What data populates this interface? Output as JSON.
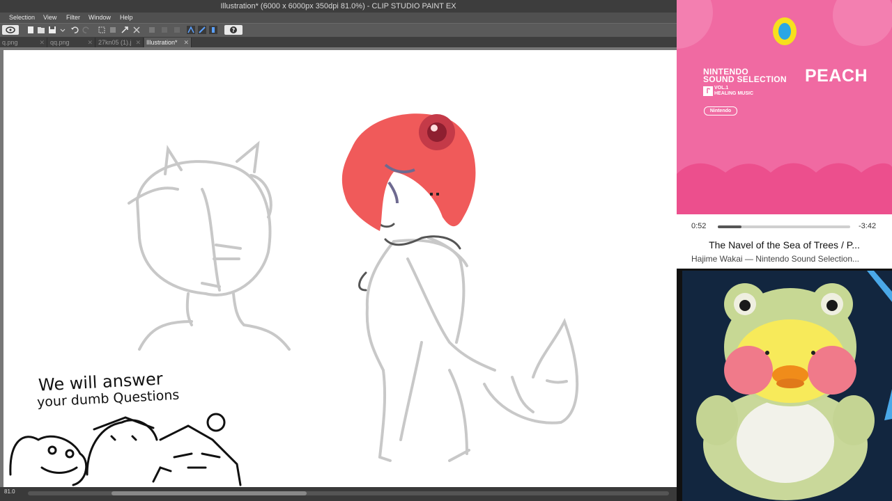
{
  "window": {
    "title": "Illustration* (6000 x 6000px 350dpi 81.0%)  - CLIP STUDIO PAINT EX"
  },
  "menu": {
    "items": [
      "Selection",
      "View",
      "Filter",
      "Window",
      "Help"
    ]
  },
  "tabs": [
    {
      "label": "q.png",
      "active": false
    },
    {
      "label": "qq.png",
      "active": false
    },
    {
      "label": "27kn05 (1).j",
      "active": false
    },
    {
      "label": "Illustration*",
      "active": true
    }
  ],
  "toolbar": {
    "icons": [
      "new-file-icon",
      "open-file-icon",
      "save-icon",
      "undo-icon",
      "redo-icon",
      "selection-icon",
      "fill-icon",
      "transform-icon",
      "snap-icon",
      "ruler-icon",
      "help-icon"
    ]
  },
  "canvas": {
    "overlay_line1": "We will answer",
    "overlay_line2": "your dumb Questions"
  },
  "status": {
    "zoom": "81.0"
  },
  "music": {
    "album": {
      "brand_line1": "NINTENDO",
      "brand_line2": "SOUND SELECTION",
      "vol_line1": "VOL.1",
      "vol_line2": "HEALING MUSIC",
      "logo": "Nintendo",
      "title": "PEACH"
    },
    "elapsed": "0:52",
    "remaining": "-3:42",
    "progress_fraction": 0.18,
    "song_title": "The Navel of the Sea of Trees / P...",
    "song_artist": "Hajime Wakai — Nintendo Sound Selection..."
  },
  "colors": {
    "album_pink": "#f06aa2",
    "album_pink_dark": "#ec4f8d",
    "hair_red": "#f05a5a",
    "webcam_bg": "#12263f"
  }
}
